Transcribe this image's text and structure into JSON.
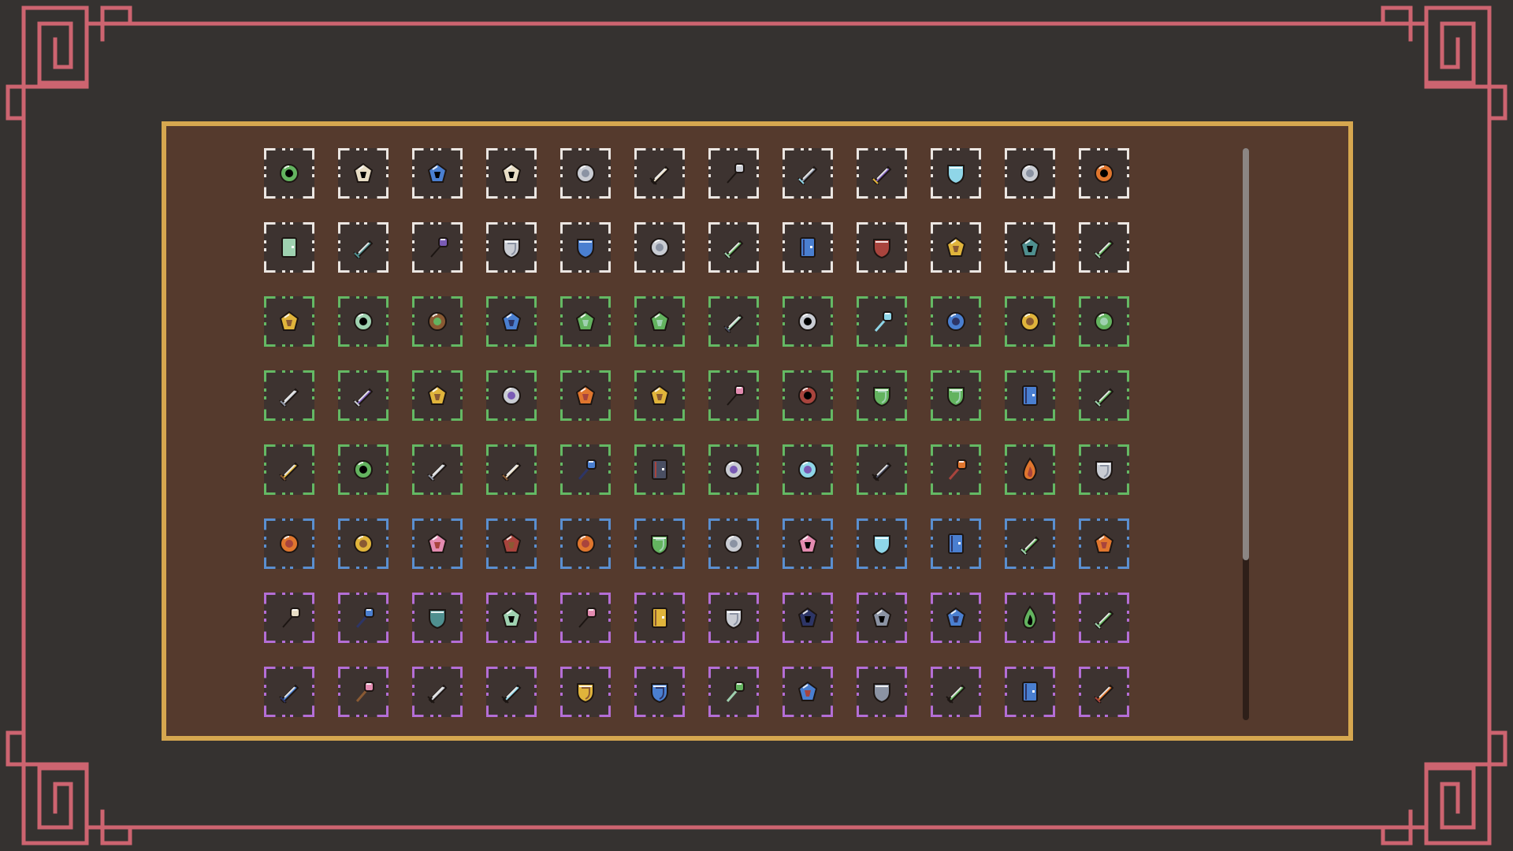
{
  "theme": {
    "background": "#353230",
    "frame": "#cd6470",
    "panel_border": "#d6a74f",
    "panel_fill": "#553a2d",
    "slot_fill": "#3d3330"
  },
  "rarity_colors": {
    "common": "#ebe6e2",
    "uncommon": "#64b964",
    "rare": "#5a8fd0",
    "epic": "#b46ed6"
  },
  "inventory": {
    "rows": [
      {
        "rarity": "common",
        "items": [
          "gem-shard-icon",
          "bandage-icon",
          "leather-scrap-icon",
          "arrows-icon",
          "iron-orb-icon",
          "dagger-icon",
          "mace-icon",
          "knife-icon",
          "broadsword-icon",
          "hood-icon",
          "steel-orb-icon",
          "dark-orb-icon"
        ]
      },
      {
        "rarity": "common",
        "items": [
          "scroll-coil-icon",
          "short-blade-icon",
          "war-hammer-icon",
          "chain-armor-icon",
          "leather-boots-icon",
          "pearl-icon",
          "green-sword-icon",
          "tome-icon",
          "buckler-icon",
          "golden-bell-icon",
          "cloth-bandage-icon",
          "jade-sword-icon"
        ]
      },
      {
        "rarity": "uncommon",
        "items": [
          "golden-boomerang-icon",
          "striped-stone-icon",
          "milk-drop-icon",
          "blue-scarf-icon",
          "green-feather-icon",
          "green-quill-icon",
          "small-knife-icon",
          "round-stone-icon",
          "torch-icon",
          "blue-gem-icon",
          "rune-stone-icon",
          "moss-orb-icon"
        ]
      },
      {
        "rarity": "uncommon",
        "items": [
          "white-sword-icon",
          "long-dagger-icon",
          "bread-icon",
          "crystal-icon",
          "copper-ore-icon",
          "amber-amulet-icon",
          "battle-axe-icon",
          "teal-orb-icon",
          "mint-armor-icon",
          "green-boots-icon",
          "blue-tome-icon",
          "emerald-sword-icon"
        ]
      },
      {
        "rarity": "uncommon",
        "items": [
          "golden-dagger-icon",
          "eyeball-icon",
          "steel-sword-icon",
          "bronze-sword-icon",
          "ice-wand-icon",
          "parchment-icon",
          "crystal-ball-icon",
          "target-ring-icon",
          "crossed-swords-icon",
          "fire-brush-icon",
          "flame-icon",
          "iron-shield-icon"
        ]
      },
      {
        "rarity": "rare",
        "items": [
          "fire-ring-icon",
          "gold-coin-icon",
          "potion-flask-icon",
          "bundle-sticks-icon",
          "ruby-icon",
          "leaf-cloak-icon",
          "silver-orb-icon",
          "spearhead-icon",
          "scale-armor-icon",
          "spellbook-icon",
          "emerald-blade-icon",
          "red-feather-icon"
        ]
      },
      {
        "rarity": "epic",
        "items": [
          "mystic-staff-icon",
          "azure-scepter-icon",
          "kite-shield-icon",
          "rose-icon",
          "rocket-wand-icon",
          "gold-scroll-icon",
          "steel-helmet-icon",
          "horn-icon",
          "spider-icon",
          "sapphire-icon",
          "comet-icon",
          "jade-dagger-icon"
        ]
      },
      {
        "rarity": "epic",
        "items": [
          "azure-sword-icon",
          "wooden-staff-icon",
          "serpent-blade-icon",
          "wing-dagger-icon",
          "golden-crest-icon",
          "blue-helm-icon",
          "emerald-wand-icon",
          "mesh-net-icon",
          "dark-helm-icon",
          "twin-blades-icon",
          "ancient-tome-icon",
          "crimson-dagger-icon"
        ]
      }
    ]
  },
  "scroll": {
    "position": 0,
    "visible_fraction": 0.72
  }
}
